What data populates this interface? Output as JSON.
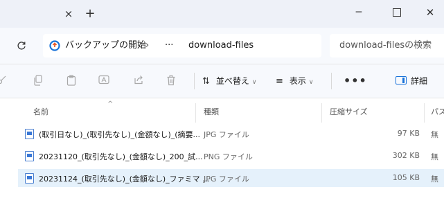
{
  "titlebar": {
    "close_tab": "×",
    "new_tab": "+",
    "minimize": "─",
    "close_window": "✕"
  },
  "address": {
    "breadcrumb": [
      {
        "label": "バックアップの開始"
      },
      {
        "label": "›"
      },
      {
        "label": "···"
      },
      {
        "label": "download-files"
      }
    ],
    "search_placeholder": "download-filesの検索"
  },
  "toolbar": {
    "sort_label": "並べ替え",
    "view_label": "表示",
    "more_label": "•••",
    "details_label": "詳細"
  },
  "columns": {
    "name": "名前",
    "type": "種類",
    "compressed_size": "圧縮サイズ",
    "password": "パスワ"
  },
  "files": [
    {
      "name": "(取引日なし)_(取引先なし)_(金額なし)_(摘要...",
      "type": "JPG ファイル",
      "size": "97 KB",
      "password": "無",
      "selected": false
    },
    {
      "name": "20231120_(取引先なし)_(金額なし)_200_試...",
      "type": "PNG ファイル",
      "size": "302 KB",
      "password": "無",
      "selected": false
    },
    {
      "name": "20231124_(取引先なし)_(金額なし)_ファミマ ...",
      "type": "JPG ファイル",
      "size": "105 KB",
      "password": "無",
      "selected": true
    }
  ],
  "colors": {
    "accent": "#1a73d9",
    "selected_row": "#e5f1fb",
    "chrome": "#eef1f8"
  }
}
